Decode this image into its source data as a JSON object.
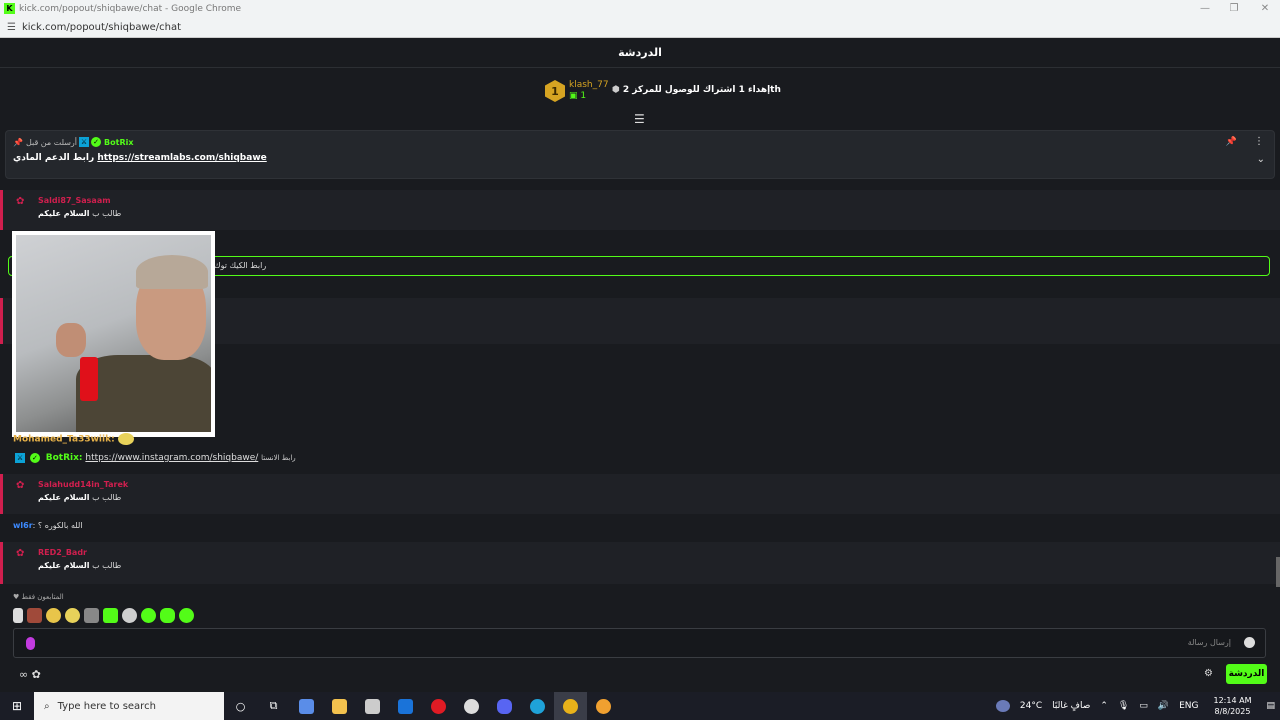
{
  "window": {
    "title": "kick.com/popout/shiqbawe/chat - Google Chrome",
    "url": "kick.com/popout/shiqbawe/chat",
    "controls": [
      "—",
      "❐",
      "✕"
    ]
  },
  "header": {
    "title": "الدردشة"
  },
  "leaderboard": {
    "rank": "1",
    "username": "klash_77",
    "count": "1",
    "info": "إهداء 1 اشتراك للوصول للمركز 2",
    "suffix": "th"
  },
  "pinned": {
    "sent_by_label": "أرسلت من قبل",
    "user": "BotRix",
    "text_label": "رابط الدعم المادي",
    "link": "https://streamlabs.com/shiqbawe"
  },
  "messages": [
    {
      "user": "Saldi87_Sasaam",
      "text_prefix": "طالب ب",
      "text_bold": "السلام عليكم"
    },
    {
      "user": "Salahudd14in_Tarek",
      "text_prefix": "طالب ب",
      "text_bold": "السلام عليكم"
    },
    {
      "user": "RED2_Badr",
      "text_prefix": "طالب ب",
      "text_bold": "السلام عليكم"
    }
  ],
  "kick_box": {
    "text": "رابط الكيك توك"
  },
  "plain_messages": {
    "mohamed": {
      "user": "Mohamed_Ta33wiik:"
    },
    "botrix": {
      "user": "BotRix:",
      "link": "https://www.instagram.com/shiqbawe/",
      "tail": "رابط الانستا"
    },
    "wl6r": {
      "user": "wl6r",
      "text": ": الله بالكوره ؟"
    }
  },
  "followers_only": "المتابعون فقط",
  "input": {
    "placeholder": "إرسال رسالة"
  },
  "chat_button": "الدردشة",
  "taskbar": {
    "search_placeholder": "Type here to search",
    "weather_temp": "24°C",
    "weather_text": "صافٍ غالبًا",
    "lang": "ENG",
    "time": "12:14 AM",
    "date": "8/8/2025"
  },
  "colors": {
    "kick_green": "#53fc18",
    "gift_red": "#d01f4e",
    "gold": "#d6a422",
    "background": "#191b1f"
  },
  "icons": {
    "pin": "pin-icon",
    "more": "more-vertical-icon",
    "chevron": "chevron-down-icon",
    "gift": "gift-icon",
    "settings": "gear-icon",
    "mic": "mic-icon",
    "emoji": "emoji-icon",
    "infinity": "infinity-icon",
    "search": "search-icon"
  }
}
